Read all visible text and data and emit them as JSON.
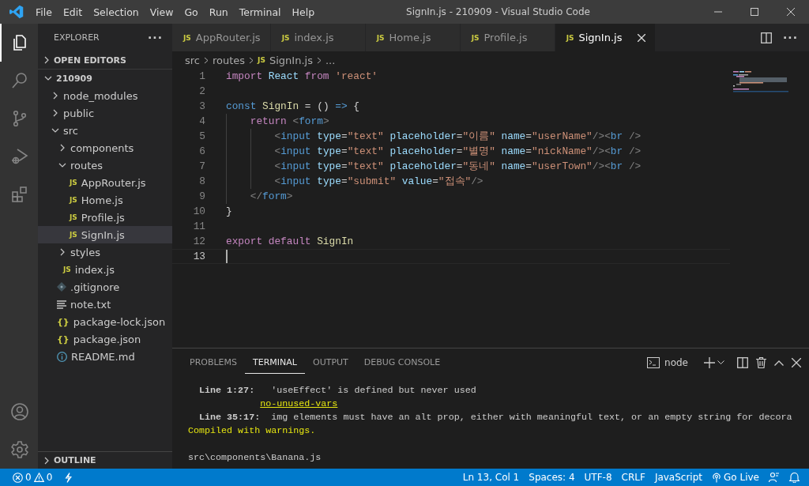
{
  "window": {
    "title": "SignIn.js - 210909 - Visual Studio Code"
  },
  "menu": [
    "File",
    "Edit",
    "Selection",
    "View",
    "Go",
    "Run",
    "Terminal",
    "Help"
  ],
  "activity_bar": [
    {
      "kind": "explorer",
      "selected": true
    },
    {
      "kind": "search",
      "selected": false
    },
    {
      "kind": "source-control",
      "selected": false
    },
    {
      "kind": "run",
      "selected": false
    },
    {
      "kind": "extensions",
      "selected": false
    }
  ],
  "activity_bar_bottom": [
    {
      "kind": "account"
    },
    {
      "kind": "settings"
    }
  ],
  "sidebar": {
    "title": "EXPLORER",
    "more": "···",
    "open_editors": {
      "label": "OPEN EDITORS",
      "expanded": false
    },
    "tree": [
      {
        "label": "210909",
        "kind": "root",
        "expanded": true,
        "selected": false,
        "children": [
          {
            "label": "node_modules",
            "kind": "folder",
            "expanded": false,
            "selected": false
          },
          {
            "label": "public",
            "kind": "folder",
            "expanded": false,
            "selected": false
          },
          {
            "label": "src",
            "kind": "folder",
            "expanded": true,
            "selected": false,
            "children": [
              {
                "label": "components",
                "kind": "folder",
                "expanded": false,
                "selected": false
              },
              {
                "label": "routes",
                "kind": "folder",
                "expanded": true,
                "selected": false,
                "children": [
                  {
                    "label": "AppRouter.js",
                    "kind": "js",
                    "badge": "JS",
                    "selected": false
                  },
                  {
                    "label": "Home.js",
                    "kind": "js",
                    "badge": "JS",
                    "selected": false
                  },
                  {
                    "label": "Profile.js",
                    "kind": "js",
                    "badge": "JS",
                    "selected": false
                  },
                  {
                    "label": "SignIn.js",
                    "kind": "js",
                    "badge": "JS",
                    "selected": true
                  }
                ]
              },
              {
                "label": "styles",
                "kind": "folder",
                "expanded": false,
                "selected": false
              },
              {
                "label": "index.js",
                "kind": "js",
                "badge": "JS",
                "selected": false
              }
            ]
          },
          {
            "label": ".gitignore",
            "kind": "git",
            "selected": false
          },
          {
            "label": "note.txt",
            "kind": "text",
            "selected": false
          },
          {
            "label": "package-lock.json",
            "kind": "json",
            "badge": "{}",
            "selected": false
          },
          {
            "label": "package.json",
            "kind": "json",
            "badge": "{}",
            "selected": false
          },
          {
            "label": "README.md",
            "kind": "info",
            "selected": false
          }
        ]
      }
    ],
    "outline": {
      "label": "OUTLINE",
      "expanded": false
    }
  },
  "tabs": [
    {
      "label": "AppRouter.js",
      "badge": "JS",
      "selected": false
    },
    {
      "label": "index.js",
      "badge": "JS",
      "selected": false
    },
    {
      "label": "Home.js",
      "badge": "JS",
      "selected": false
    },
    {
      "label": "Profile.js",
      "badge": "JS",
      "selected": false
    },
    {
      "label": "SignIn.js",
      "badge": "JS",
      "selected": true
    }
  ],
  "breadcrumb": [
    {
      "label": "src"
    },
    {
      "label": "routes"
    },
    {
      "label": "SignIn.js",
      "badge": "JS"
    },
    {
      "label": "..."
    }
  ],
  "code": {
    "lines": [
      {
        "number": "1",
        "current": false,
        "tokens": [
          {
            "kind": "keyword",
            "text": "import"
          },
          {
            "kind": "variable",
            "text": " React"
          },
          {
            "kind": "keyword",
            "text": " from"
          },
          {
            "kind": "string",
            "text": " 'react'"
          }
        ]
      },
      {
        "number": "2",
        "current": false
      },
      {
        "number": "3",
        "current": false,
        "tokens": [
          {
            "kind": "storage",
            "text": "const"
          },
          {
            "kind": "function",
            "text": " SignIn"
          },
          {
            "kind": "plain",
            "text": " = () "
          },
          {
            "kind": "storage",
            "text": "=>"
          },
          {
            "kind": "plain",
            "text": " {"
          }
        ]
      },
      {
        "number": "4",
        "current": false,
        "tokens": [
          {
            "kind": "keyword",
            "text": "    return"
          },
          {
            "kind": "bracket",
            "text": " <"
          },
          {
            "kind": "tag",
            "text": "form"
          },
          {
            "kind": "bracket",
            "text": ">"
          }
        ]
      },
      {
        "number": "5",
        "current": false,
        "tokens": [
          {
            "kind": "bracket",
            "text": "        <"
          },
          {
            "kind": "tag",
            "text": "input"
          },
          {
            "kind": "attr",
            "text": " type"
          },
          {
            "kind": "plain",
            "text": "="
          },
          {
            "kind": "string",
            "text": "\"text\""
          },
          {
            "kind": "attr",
            "text": " placeholder"
          },
          {
            "kind": "plain",
            "text": "="
          },
          {
            "kind": "string",
            "text": "\"이름\""
          },
          {
            "kind": "attr",
            "text": " name"
          },
          {
            "kind": "plain",
            "text": "="
          },
          {
            "kind": "string",
            "text": "\"userName\""
          },
          {
            "kind": "bracket",
            "text": "/><"
          },
          {
            "kind": "tag",
            "text": "br"
          },
          {
            "kind": "bracket",
            "text": " />"
          }
        ]
      },
      {
        "number": "6",
        "current": false,
        "tokens": [
          {
            "kind": "bracket",
            "text": "        <"
          },
          {
            "kind": "tag",
            "text": "input"
          },
          {
            "kind": "attr",
            "text": " type"
          },
          {
            "kind": "plain",
            "text": "="
          },
          {
            "kind": "string",
            "text": "\"text\""
          },
          {
            "kind": "attr",
            "text": " placeholder"
          },
          {
            "kind": "plain",
            "text": "="
          },
          {
            "kind": "string",
            "text": "\"별명\""
          },
          {
            "kind": "attr",
            "text": " name"
          },
          {
            "kind": "plain",
            "text": "="
          },
          {
            "kind": "string",
            "text": "\"nickName\""
          },
          {
            "kind": "bracket",
            "text": "/><"
          },
          {
            "kind": "tag",
            "text": "br"
          },
          {
            "kind": "bracket",
            "text": " />"
          }
        ]
      },
      {
        "number": "7",
        "current": false,
        "tokens": [
          {
            "kind": "bracket",
            "text": "        <"
          },
          {
            "kind": "tag",
            "text": "input"
          },
          {
            "kind": "attr",
            "text": " type"
          },
          {
            "kind": "plain",
            "text": "="
          },
          {
            "kind": "string",
            "text": "\"text\""
          },
          {
            "kind": "attr",
            "text": " placeholder"
          },
          {
            "kind": "plain",
            "text": "="
          },
          {
            "kind": "string",
            "text": "\"동네\""
          },
          {
            "kind": "attr",
            "text": " name"
          },
          {
            "kind": "plain",
            "text": "="
          },
          {
            "kind": "string",
            "text": "\"userTown\""
          },
          {
            "kind": "bracket",
            "text": "/><"
          },
          {
            "kind": "tag",
            "text": "br"
          },
          {
            "kind": "bracket",
            "text": " />"
          }
        ]
      },
      {
        "number": "8",
        "current": false,
        "tokens": [
          {
            "kind": "bracket",
            "text": "        <"
          },
          {
            "kind": "tag",
            "text": "input"
          },
          {
            "kind": "attr",
            "text": " type"
          },
          {
            "kind": "plain",
            "text": "="
          },
          {
            "kind": "string",
            "text": "\"submit\""
          },
          {
            "kind": "attr",
            "text": " value"
          },
          {
            "kind": "plain",
            "text": "="
          },
          {
            "kind": "string",
            "text": "\"접속\""
          },
          {
            "kind": "bracket",
            "text": "/>"
          }
        ]
      },
      {
        "number": "9",
        "current": false,
        "tokens": [
          {
            "kind": "bracket",
            "text": "    </"
          },
          {
            "kind": "tag",
            "text": "form"
          },
          {
            "kind": "bracket",
            "text": ">"
          }
        ]
      },
      {
        "number": "10",
        "current": false,
        "tokens": [
          {
            "kind": "plain",
            "text": "}"
          }
        ]
      },
      {
        "number": "11",
        "current": false
      },
      {
        "number": "12",
        "current": false,
        "tokens": [
          {
            "kind": "keyword",
            "text": "export default"
          },
          {
            "kind": "function",
            "text": " SignIn"
          }
        ]
      },
      {
        "number": "13",
        "current": true
      }
    ]
  },
  "panel": {
    "tabs": [
      {
        "label": "PROBLEMS",
        "selected": false
      },
      {
        "label": "TERMINAL",
        "selected": true
      },
      {
        "label": "OUTPUT",
        "selected": false
      },
      {
        "label": "DEBUG CONSOLE",
        "selected": false
      }
    ],
    "shell": "node",
    "terminal": [
      {
        "kind": "lint",
        "text": "**Line 1:27:**   'useEffect' is defined but never used"
      },
      {
        "kind": "rule",
        "text": "no-unused-vars"
      },
      {
        "kind": "lint",
        "text": "**Line 35:17:**  img elements must have an alt prop, either with meaningful text, or an empty string for decora"
      },
      {
        "kind": "warning",
        "text": "Compiled with warnings."
      },
      {
        "kind": "path",
        "text": "src\\components\\Banana.js"
      }
    ]
  },
  "status_bar": {
    "errors": "0",
    "warnings": "0",
    "right": [
      {
        "kind": "text",
        "text": "Ln 13, Col 1"
      },
      {
        "kind": "text",
        "text": "Spaces: 4"
      },
      {
        "kind": "text",
        "text": "UTF-8"
      },
      {
        "kind": "text",
        "text": "CRLF"
      },
      {
        "kind": "text",
        "text": "JavaScript"
      },
      {
        "kind": "live",
        "text": "Go Live"
      },
      {
        "kind": "feedback"
      },
      {
        "kind": "bell"
      }
    ]
  }
}
